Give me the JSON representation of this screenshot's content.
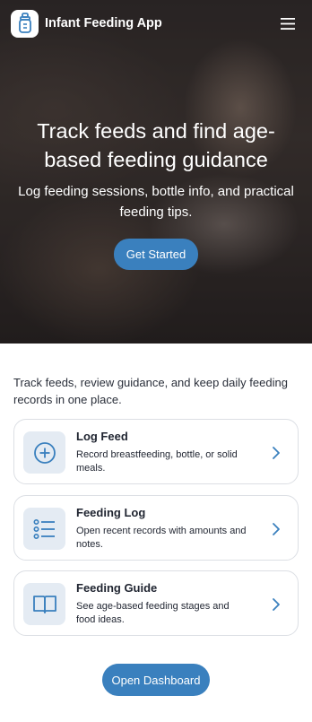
{
  "app": {
    "title": "Infant Feeding App",
    "icon": "baby-bottle-icon",
    "menu_icon": "hamburger-menu-icon"
  },
  "hero": {
    "title": "Track feeds and find age-based feeding guidance",
    "subtitle": "Log feeding sessions, bottle info, and practical feeding tips.",
    "cta_label": "Get Started"
  },
  "intro": "Track feeds, review guidance, and keep daily feeding records in one place.",
  "cards": [
    {
      "title": "Log Feed",
      "description": "Record breastfeeding, bottle, or solid meals.",
      "icon": "plus-circle-icon"
    },
    {
      "title": "Feeding Log",
      "description": "Open recent records with amounts and notes.",
      "icon": "list-icon"
    },
    {
      "title": "Feeding Guide",
      "description": "See age-based feeding stages and food ideas.",
      "icon": "open-book-icon"
    }
  ],
  "dashboard_button": "Open Dashboard",
  "colors": {
    "accent": "#3a80be",
    "icon_tile": "#e4ebf3",
    "card_border": "#dcdfe4"
  }
}
